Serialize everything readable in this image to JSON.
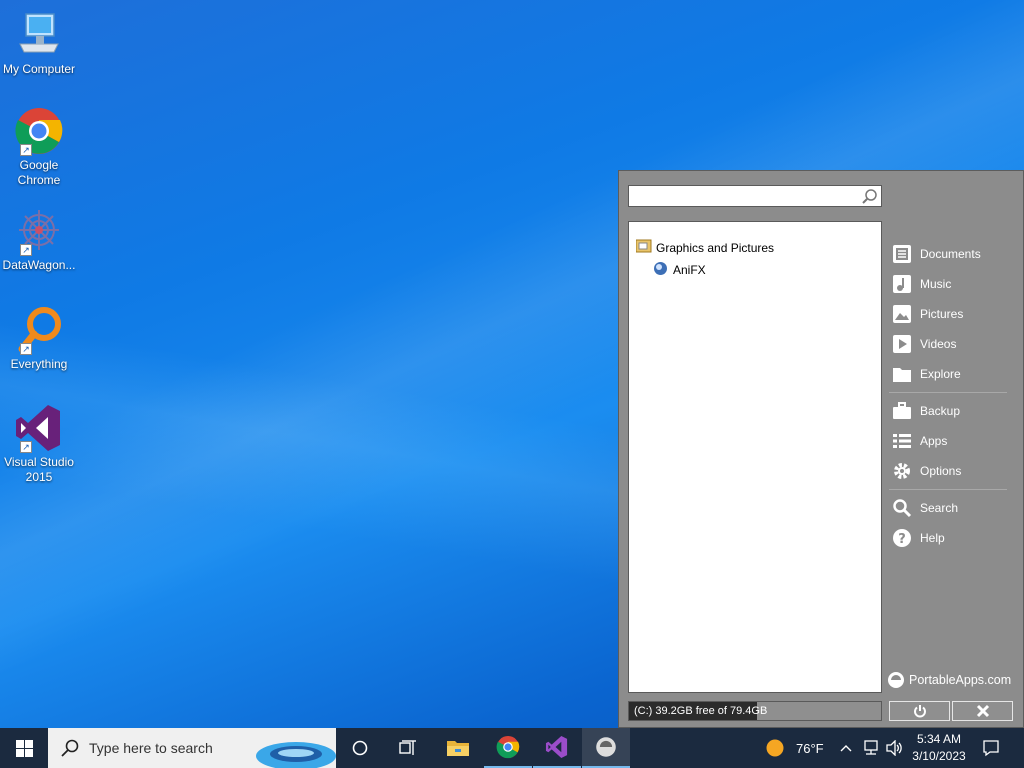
{
  "desktop": {
    "icons": [
      {
        "label": "My Computer",
        "icon": "computer-icon"
      },
      {
        "label": "Google Chrome",
        "icon": "chrome-icon"
      },
      {
        "label": "DataWagon...",
        "icon": "datawagon-icon"
      },
      {
        "label": "Everything",
        "icon": "everything-search-icon"
      },
      {
        "label": "Visual Studio 2015",
        "icon": "visual-studio-icon"
      }
    ]
  },
  "portable_menu": {
    "search_value": "",
    "category": "Graphics and Pictures",
    "apps": [
      "AniFX"
    ],
    "side_items": [
      {
        "label": "Documents",
        "icon": "documents-icon"
      },
      {
        "label": "Music",
        "icon": "music-icon"
      },
      {
        "label": "Pictures",
        "icon": "pictures-icon"
      },
      {
        "label": "Videos",
        "icon": "videos-icon"
      },
      {
        "label": "Explore",
        "icon": "folder-icon"
      },
      {
        "label": "Backup",
        "icon": "briefcase-icon"
      },
      {
        "label": "Apps",
        "icon": "apps-list-icon"
      },
      {
        "label": "Options",
        "icon": "gear-icon"
      },
      {
        "label": "Search",
        "icon": "search-icon"
      },
      {
        "label": "Help",
        "icon": "help-icon"
      }
    ],
    "logo_text": "PortableApps.com",
    "drive_status": "(C:) 39.2GB free of 79.4GB",
    "drive_used_fraction": 0.506,
    "accent": "#8c8c8c"
  },
  "taskbar": {
    "search_placeholder": "Type here to search",
    "weather": "76°F",
    "time": "5:34 AM",
    "date": "3/10/2023",
    "background": "#1b2a3f"
  }
}
